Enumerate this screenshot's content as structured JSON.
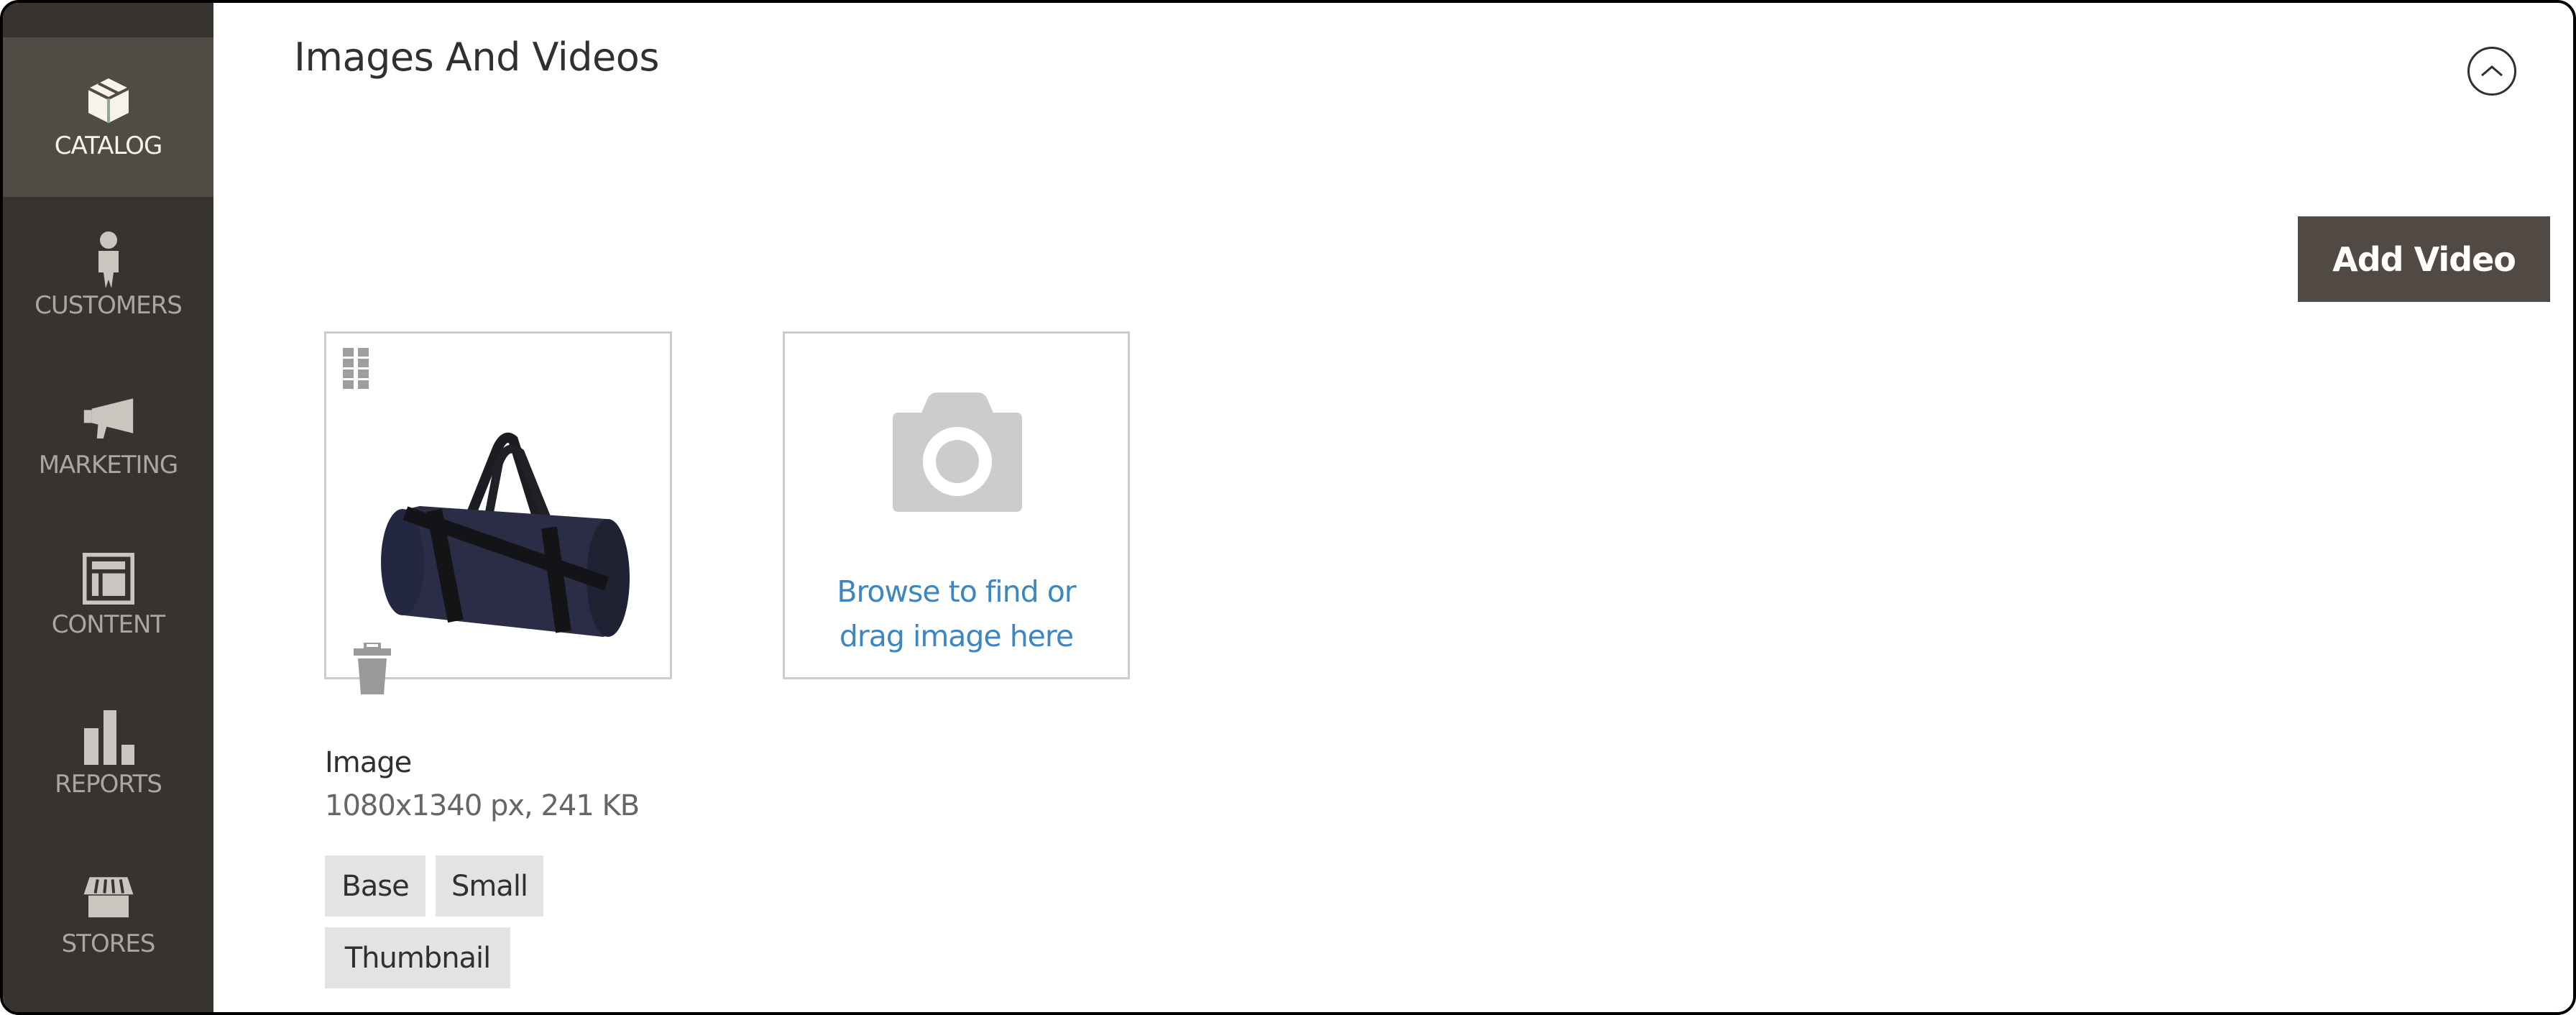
{
  "sidebar": {
    "items": [
      {
        "label": "Catalog",
        "icon": "box-icon",
        "active": true
      },
      {
        "label": "Customers",
        "icon": "person-icon",
        "active": false
      },
      {
        "label": "Marketing",
        "icon": "megaphone-icon",
        "active": false
      },
      {
        "label": "Content",
        "icon": "layout-icon",
        "active": false
      },
      {
        "label": "Reports",
        "icon": "bar-chart-icon",
        "active": false
      },
      {
        "label": "Stores",
        "icon": "storefront-icon",
        "active": false
      }
    ]
  },
  "section": {
    "title": "Images And Videos",
    "collapse_icon": "chevron-up-circle-icon",
    "add_video_label": "Add Video"
  },
  "images": [
    {
      "name": "Image",
      "meta": "1080x1340 px, 241 KB",
      "roles": [
        "Base",
        "Small",
        "Thumbnail"
      ]
    }
  ],
  "upload": {
    "line1": "Browse to find or",
    "line2": "drag image here"
  },
  "colors": {
    "sidebar_bg": "#373330",
    "sidebar_active_bg": "#514b46",
    "button_bg": "#514943",
    "link": "#3d86c0",
    "tag_bg": "#e3e3e3"
  }
}
